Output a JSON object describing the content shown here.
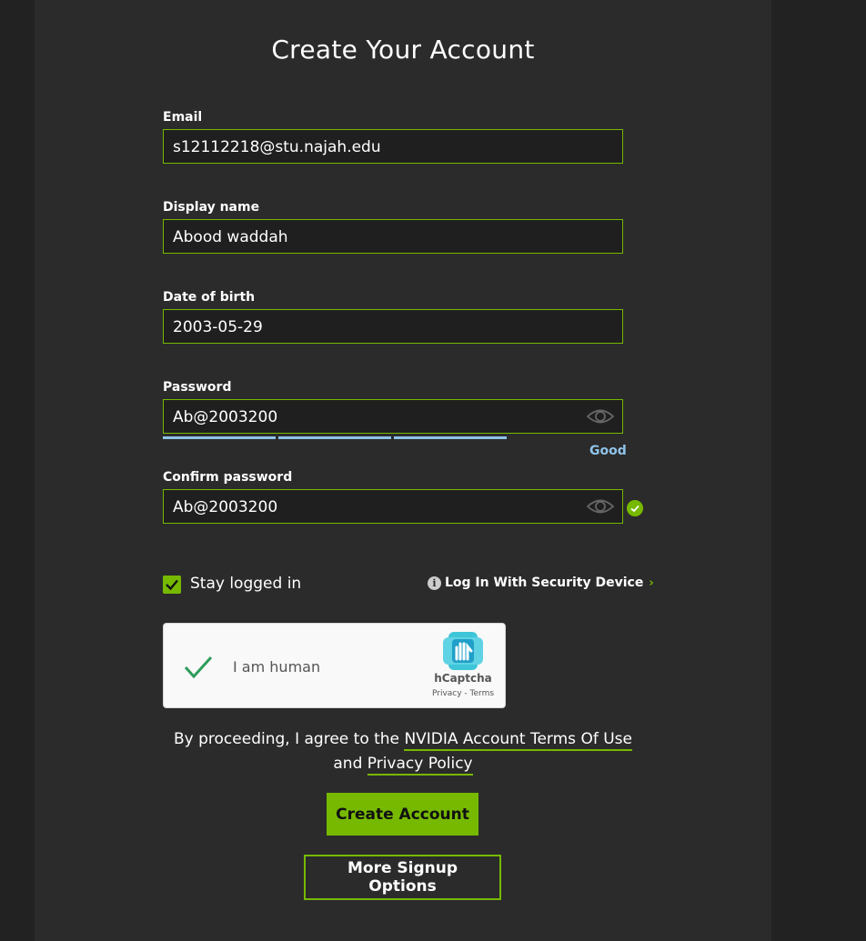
{
  "page": {
    "title": "Create Your Account"
  },
  "form": {
    "email": {
      "label": "Email",
      "value": "s12112218@stu.najah.edu"
    },
    "display_name": {
      "label": "Display name",
      "value": "Abood waddah"
    },
    "dob": {
      "label": "Date of birth",
      "value": "2003-05-29"
    },
    "password": {
      "label": "Password",
      "value": "Ab@2003200",
      "strength_label": "Good",
      "strength_segments_filled": 3,
      "strength_segments_total": 4
    },
    "confirm_password": {
      "label": "Confirm password",
      "value": "Ab@2003200"
    }
  },
  "options": {
    "stay_logged_in": "Stay logged in",
    "security_device": "Log In With Security Device"
  },
  "captcha": {
    "label": "I am human",
    "brand": "hCaptcha",
    "links": "Privacy - Terms"
  },
  "agreement": {
    "prefix": "By proceeding, I agree to the",
    "terms_link": "NVIDIA Account Terms Of Use",
    "joiner": "and",
    "privacy_link": "Privacy Policy"
  },
  "buttons": {
    "create": "Create Account",
    "more": "More Signup Options"
  },
  "colors": {
    "accent": "#76b900",
    "strength": "#8ec3ea",
    "panel": "#2b2b2b",
    "background": "#222222"
  }
}
